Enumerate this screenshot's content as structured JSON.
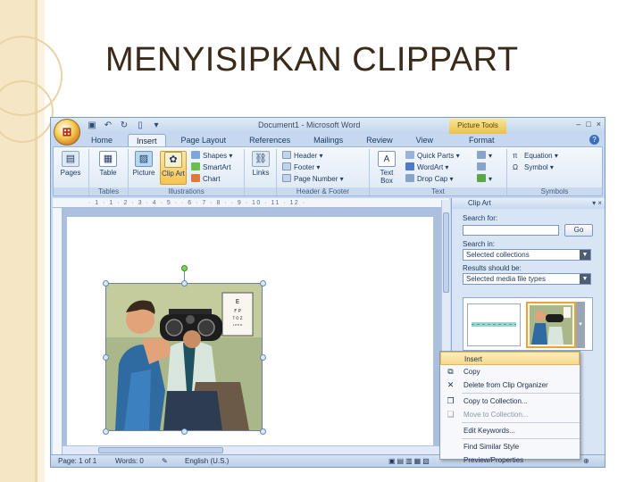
{
  "slide": {
    "title": "MENYISIPKAN CLIPPART"
  },
  "window": {
    "title": "Document1 - Microsoft Word",
    "context_tab": "Picture Tools",
    "controls": [
      "–",
      "□",
      "×"
    ]
  },
  "tabs": [
    "Home",
    "Insert",
    "Page Layout",
    "References",
    "Mailings",
    "Review",
    "View",
    "Format"
  ],
  "active_tab": "Insert",
  "ribbon": {
    "pages_label": "Pages",
    "table_label": "Table",
    "tables_group": "Tables",
    "picture_label": "Picture",
    "clipart_label": "Clip Art",
    "shapes_label": "Shapes",
    "smartart_label": "SmartArt",
    "chart_label": "Chart",
    "illustrations_group": "Illustrations",
    "links_label": "Links",
    "header_label": "Header",
    "footer_label": "Footer",
    "page_number_label": "Page Number",
    "header_footer_group": "Header & Footer",
    "textbox_label": "Text Box",
    "quickparts_label": "Quick Parts",
    "wordart_label": "WordArt",
    "dropcap_label": "Drop Cap",
    "text_group": "Text",
    "equation_label": "Equation",
    "symbol_label": "Symbol",
    "symbols_group": "Symbols"
  },
  "ruler": {
    "marks": "· 1 · 1 · 2 · 3 · 4 · 5 · · 6 · 7 · 8 · · 9 · 10 · 11 · 12 ·"
  },
  "pane": {
    "title": "Clip Art",
    "search_for": "Search for:",
    "go": "Go",
    "search_in": "Search in:",
    "search_in_value": "Selected collections",
    "results_should_be": "Results should be:",
    "results_value": "Selected media file types"
  },
  "context_menu": [
    {
      "label": "Insert",
      "icon": "",
      "highlight": true
    },
    {
      "label": "Copy",
      "icon": "copy-icon"
    },
    {
      "label": "Delete from Clip Organizer",
      "icon": "delete-icon"
    },
    {
      "label": "Copy to Collection...",
      "icon": "collection-icon"
    },
    {
      "label": "Move to Collection...",
      "icon": "move-icon",
      "disabled": true
    },
    {
      "label": "Edit Keywords...",
      "icon": ""
    },
    {
      "label": "Find Similar Style",
      "icon": ""
    },
    {
      "label": "Preview/Properties",
      "icon": ""
    }
  ],
  "status": {
    "page": "Page: 1 of 1",
    "words": "Words: 0",
    "language": "English (U.S.)"
  }
}
